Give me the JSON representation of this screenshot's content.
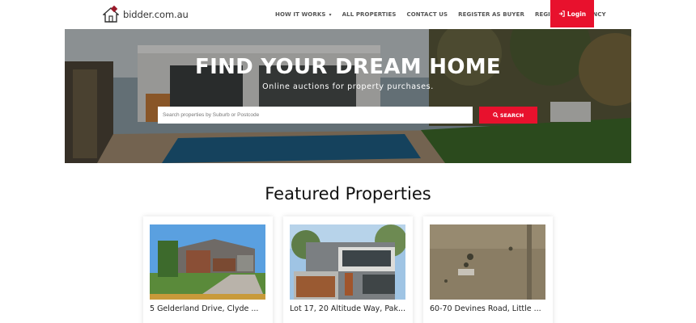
{
  "site": {
    "logo_text": "bidder.com.au"
  },
  "nav": {
    "items": [
      {
        "label": "HOW IT WORKS",
        "has_caret": true
      },
      {
        "label": "ALL PROPERTIES"
      },
      {
        "label": "CONTACT US"
      },
      {
        "label": "REGISTER AS BUYER"
      },
      {
        "label": "REGISTER AS AGENCY"
      }
    ],
    "login_label": "Login"
  },
  "hero": {
    "title": "FIND YOUR DREAM HOME",
    "subtitle": "Online auctions for property purchases.",
    "search_placeholder": "Search properties by Suburb or Postcode",
    "search_button": "SEARCH"
  },
  "featured": {
    "title": "Featured Properties",
    "cards": [
      {
        "address": "5 Gelderland Drive, Clyde ..."
      },
      {
        "address": "Lot 17, 20 Altitude Way, Pak..."
      },
      {
        "address": "60-70 Devines Road, Little ..."
      }
    ]
  },
  "colors": {
    "accent": "#e8112d"
  }
}
